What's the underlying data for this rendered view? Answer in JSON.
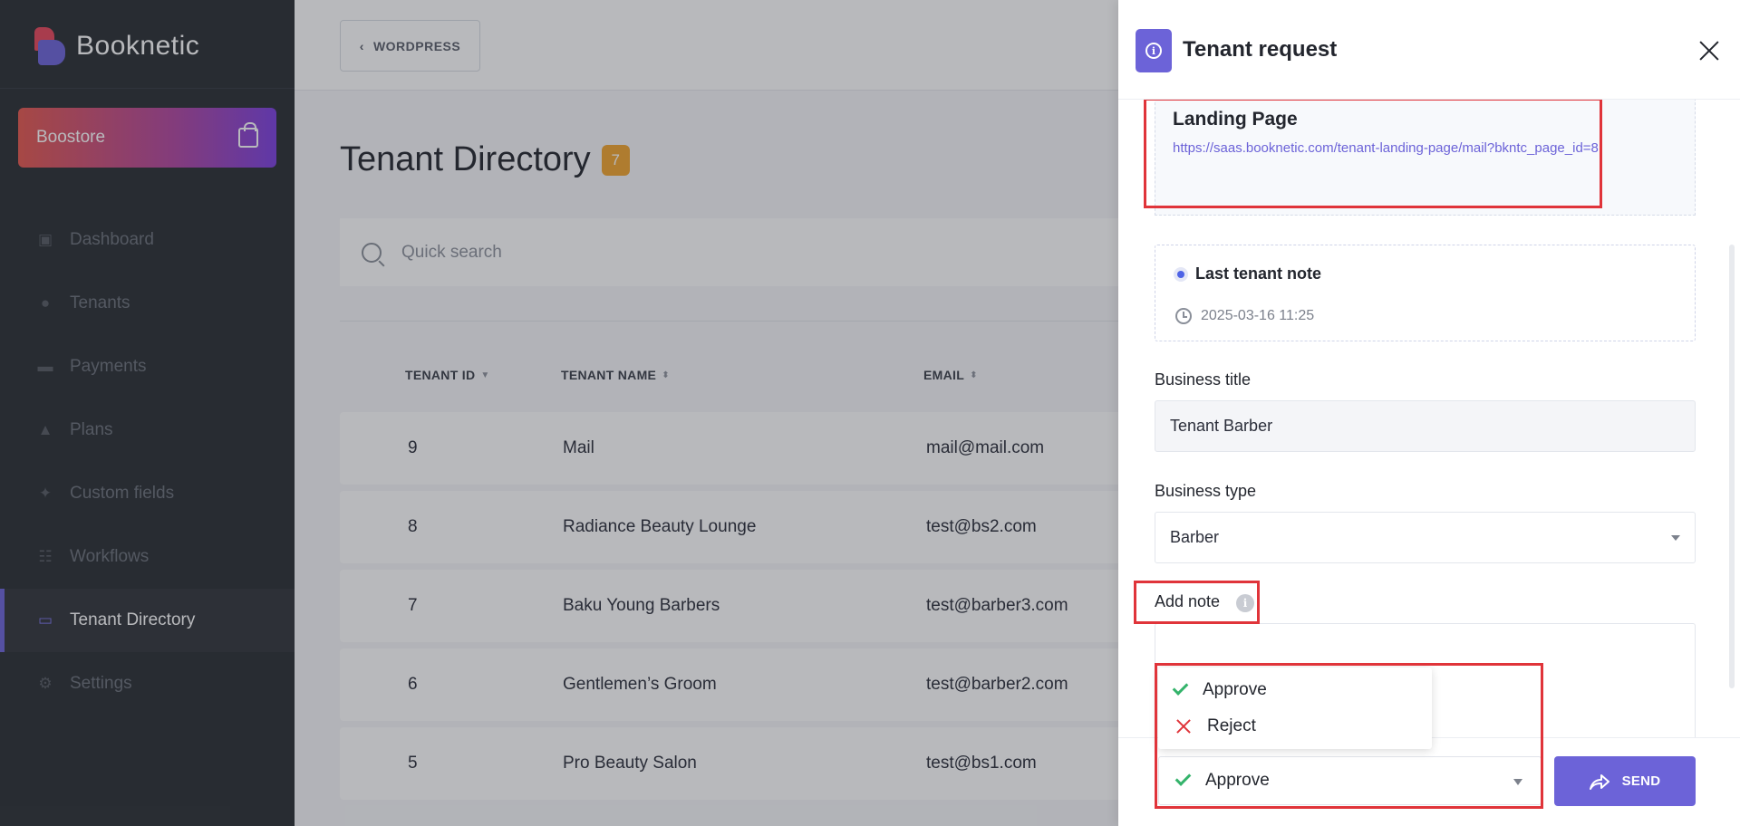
{
  "app": {
    "name": "Booknetic"
  },
  "sidebar": {
    "boostore_label": "Boostore",
    "items": [
      {
        "label": "Dashboard",
        "icon": "cube-icon"
      },
      {
        "label": "Tenants",
        "icon": "user-icon"
      },
      {
        "label": "Payments",
        "icon": "credit-card-icon"
      },
      {
        "label": "Plans",
        "icon": "rocket-icon"
      },
      {
        "label": "Custom fields",
        "icon": "magic-wand-icon"
      },
      {
        "label": "Workflows",
        "icon": "workflow-icon"
      },
      {
        "label": "Tenant Directory",
        "icon": "laptop-icon",
        "active": true
      },
      {
        "label": "Settings",
        "icon": "gear-icon"
      }
    ]
  },
  "topbar": {
    "wordpress_label": "WORDPRESS"
  },
  "page": {
    "title": "Tenant Directory",
    "count": "7",
    "search_placeholder": "Quick search"
  },
  "table": {
    "headers": [
      "TENANT ID",
      "TENANT NAME",
      "EMAIL"
    ],
    "rows": [
      {
        "id": "9",
        "name": "Mail",
        "email": "mail@mail.com"
      },
      {
        "id": "8",
        "name": "Radiance Beauty Lounge",
        "email": "test@bs2.com"
      },
      {
        "id": "7",
        "name": "Baku Young Barbers",
        "email": "test@barber3.com"
      },
      {
        "id": "6",
        "name": "Gentlemen’s Groom",
        "email": "test@barber2.com"
      },
      {
        "id": "5",
        "name": "Pro Beauty Salon",
        "email": "test@bs1.com"
      }
    ]
  },
  "drawer": {
    "title": "Tenant request",
    "landing": {
      "title": "Landing Page",
      "url": "https://saas.booknetic.com/tenant-landing-page/mail?bkntc_page_id=8"
    },
    "last_note": {
      "title": "Last tenant note",
      "time": "2025-03-16 11:25"
    },
    "business_title": {
      "label": "Business title",
      "value": "Tenant Barber"
    },
    "business_type": {
      "label": "Business type",
      "value": "Barber"
    },
    "add_note": {
      "label": "Add note",
      "info": "i"
    },
    "status": {
      "options": [
        "Approve",
        "Reject"
      ],
      "selected": "Approve"
    },
    "send_label": "SEND"
  },
  "colors": {
    "accent": "#6c63d8",
    "sidebar_bg": "#292d32",
    "highlight": "#e0343a",
    "approve": "#34b36b",
    "reject": "#e0343a",
    "badge": "#f2a52e"
  }
}
